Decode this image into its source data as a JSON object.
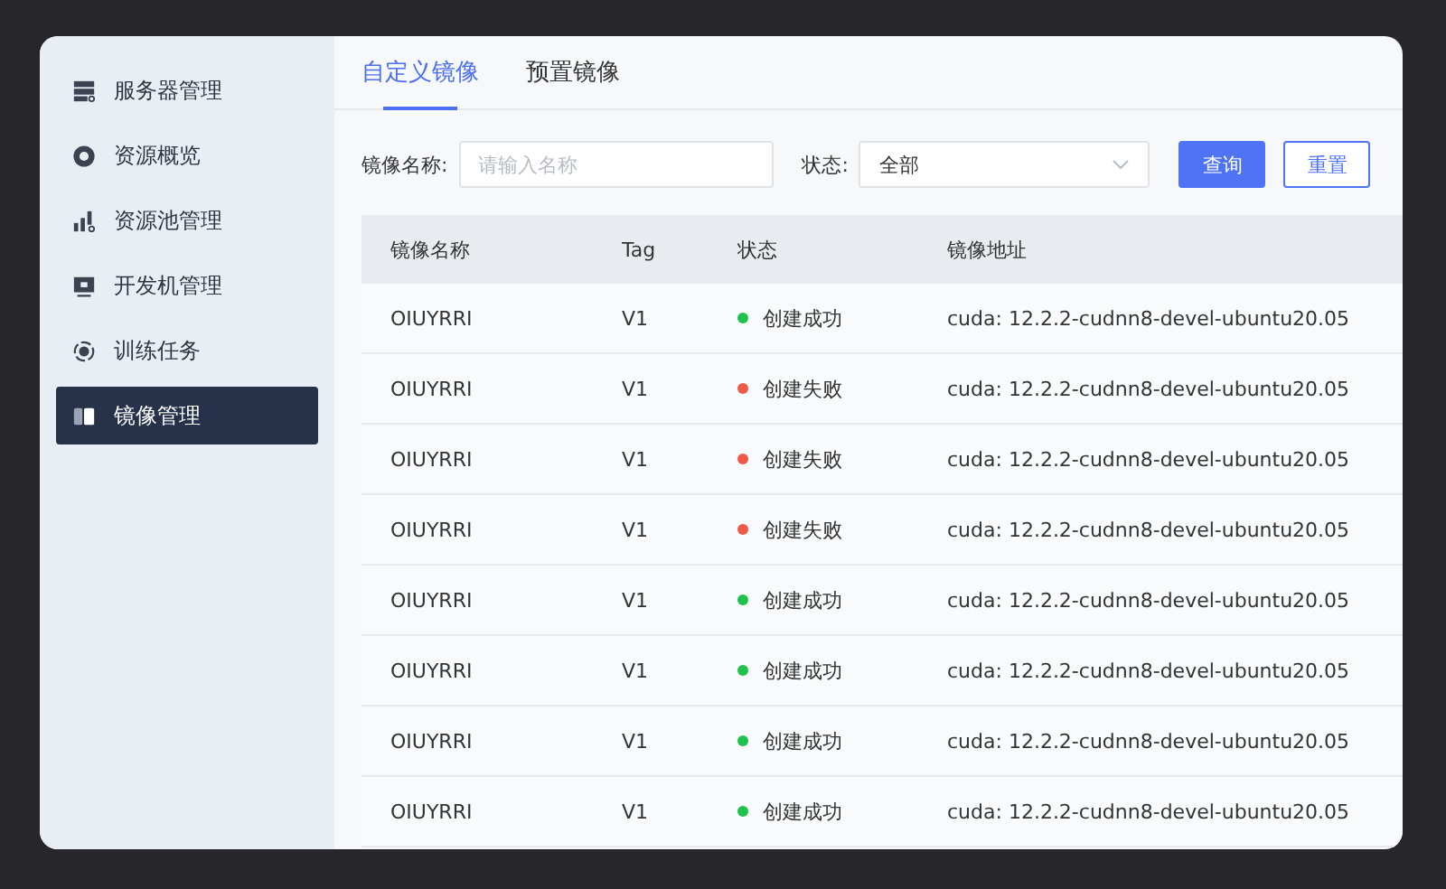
{
  "sidebar": {
    "items": [
      {
        "label": "服务器管理",
        "kind": "server",
        "selected": false
      },
      {
        "label": "资源概览",
        "kind": "donut",
        "selected": false
      },
      {
        "label": "资源池管理",
        "kind": "bars",
        "selected": false
      },
      {
        "label": "开发机管理",
        "kind": "monitor",
        "selected": false
      },
      {
        "label": "训练任务",
        "kind": "target",
        "selected": false
      },
      {
        "label": "镜像管理",
        "kind": "image",
        "selected": true
      }
    ]
  },
  "tabs": [
    {
      "label": "自定义镜像",
      "selected": true
    },
    {
      "label": "预置镜像",
      "selected": false
    }
  ],
  "filters": {
    "name_label": "镜像名称:",
    "name_placeholder": "请输入名称",
    "status_label": "状态:",
    "status_value": "全部",
    "buttons": [
      {
        "label": "查询",
        "kind": "primary"
      },
      {
        "label": "重置",
        "kind": "outline"
      }
    ]
  },
  "table": {
    "columns": [
      "镜像名称",
      "Tag",
      "状态",
      "镜像地址"
    ],
    "rows": [
      {
        "name": "OIUYRRI",
        "tag": "V1",
        "status": "创建成功",
        "color": "#1fc24a",
        "address": "cuda: 12.2.2-cudnn8-devel-ubuntu20.05"
      },
      {
        "name": "OIUYRRI",
        "tag": "V1",
        "status": "创建失败",
        "color": "#ef5a48",
        "address": "cuda: 12.2.2-cudnn8-devel-ubuntu20.05"
      },
      {
        "name": "OIUYRRI",
        "tag": "V1",
        "status": "创建失败",
        "color": "#ef5a48",
        "address": "cuda: 12.2.2-cudnn8-devel-ubuntu20.05"
      },
      {
        "name": "OIUYRRI",
        "tag": "V1",
        "status": "创建失败",
        "color": "#ef5a48",
        "address": "cuda: 12.2.2-cudnn8-devel-ubuntu20.05"
      },
      {
        "name": "OIUYRRI",
        "tag": "V1",
        "status": "创建成功",
        "color": "#1fc24a",
        "address": "cuda: 12.2.2-cudnn8-devel-ubuntu20.05"
      },
      {
        "name": "OIUYRRI",
        "tag": "V1",
        "status": "创建成功",
        "color": "#1fc24a",
        "address": "cuda: 12.2.2-cudnn8-devel-ubuntu20.05"
      },
      {
        "name": "OIUYRRI",
        "tag": "V1",
        "status": "创建成功",
        "color": "#1fc24a",
        "address": "cuda: 12.2.2-cudnn8-devel-ubuntu20.05"
      },
      {
        "name": "OIUYRRI",
        "tag": "V1",
        "status": "创建成功",
        "color": "#1fc24a",
        "address": "cuda: 12.2.2-cudnn8-devel-ubuntu20.05"
      }
    ]
  }
}
